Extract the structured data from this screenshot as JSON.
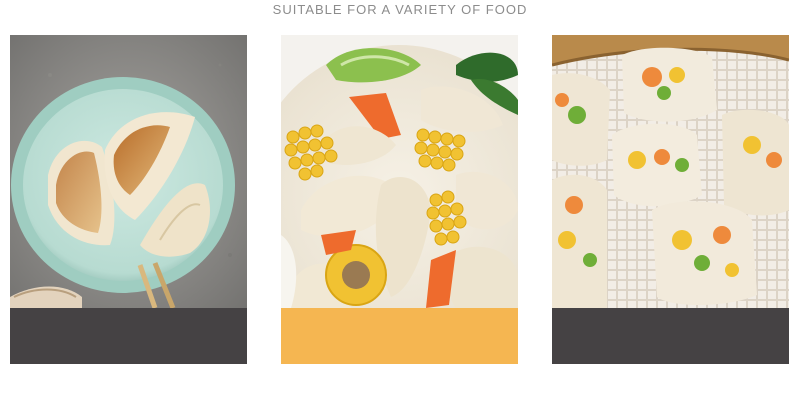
{
  "headline": "SUITABLE FOR A VARIETY OF FOOD",
  "cards": [
    {
      "photo": "pan-fried-dumplings-on-plate",
      "band_color": "#454244"
    },
    {
      "photo": "dumplings-in-soup-with-corn",
      "band_color": "#f5b651"
    },
    {
      "photo": "shaomai-in-steamer",
      "band_color": "#454244"
    }
  ],
  "colors": {
    "dough": "#efe6d2",
    "plate": "#bfe0d8",
    "corn": "#f1c232",
    "carrot": "#ee6b2d",
    "pea": "#7fb03a",
    "stone": "#9a9894"
  }
}
